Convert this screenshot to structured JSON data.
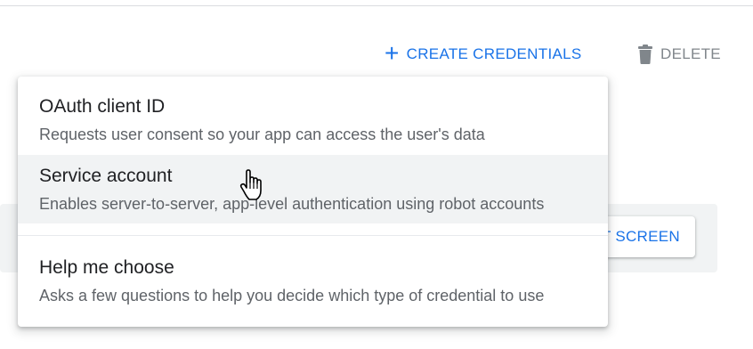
{
  "toolbar": {
    "create_label": "CREATE CREDENTIALS",
    "create_icon": "+",
    "delete_label": "DELETE"
  },
  "consent_button": {
    "label": "T SCREEN"
  },
  "menu": {
    "items": [
      {
        "title": "OAuth client ID",
        "description": "Requests user consent so your app can access the user's data"
      },
      {
        "title": "Service account",
        "description": "Enables server-to-server, app-level authentication using robot accounts"
      },
      {
        "title": "Help me choose",
        "description": "Asks a few questions to help you decide which type of credential to use"
      }
    ]
  },
  "colors": {
    "accent": "#1a73e8",
    "muted": "#80868b",
    "text_primary": "#202124",
    "text_secondary": "#5f6368",
    "hover_bg": "#f1f3f4"
  },
  "icons": {
    "create": "plus-icon",
    "delete": "trash-icon",
    "cursor": "hand-pointer-icon"
  }
}
